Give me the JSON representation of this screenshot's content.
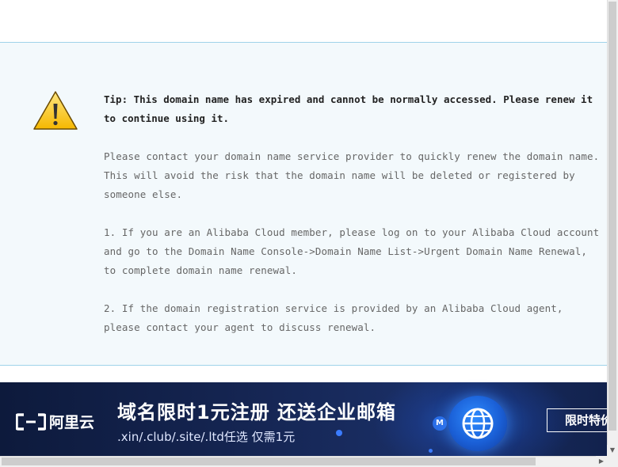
{
  "tip": {
    "title": "Tip: This domain name has expired and cannot be normally accessed. Please renew it to continue using it.",
    "paragraphs": [
      "Please contact your domain name service provider to quickly renew the domain name. This will avoid the risk that the domain name will be deleted or registered by someone else.",
      "1. If you are an Alibaba Cloud member, please log on to your Alibaba Cloud account and go to the Domain Name Console->Domain Name List->Urgent Domain Name Renewal, to complete domain name renewal.",
      "2. If the domain registration service is provided by an Alibaba Cloud agent, please contact your agent to discuss renewal."
    ],
    "icon": "warning-triangle-icon"
  },
  "banner": {
    "logo_text": "阿里云",
    "headline": "域名限时1元注册 还送企业邮箱",
    "subline": ".xin/.club/.site/.ltd任选  仅需1元",
    "cta": "限时特价",
    "badge": "M",
    "colors": {
      "bg": "#12224d",
      "accent": "#2f8cff"
    }
  },
  "scrollbars": {
    "down_arrow": "▼",
    "right_arrow": "▶"
  }
}
